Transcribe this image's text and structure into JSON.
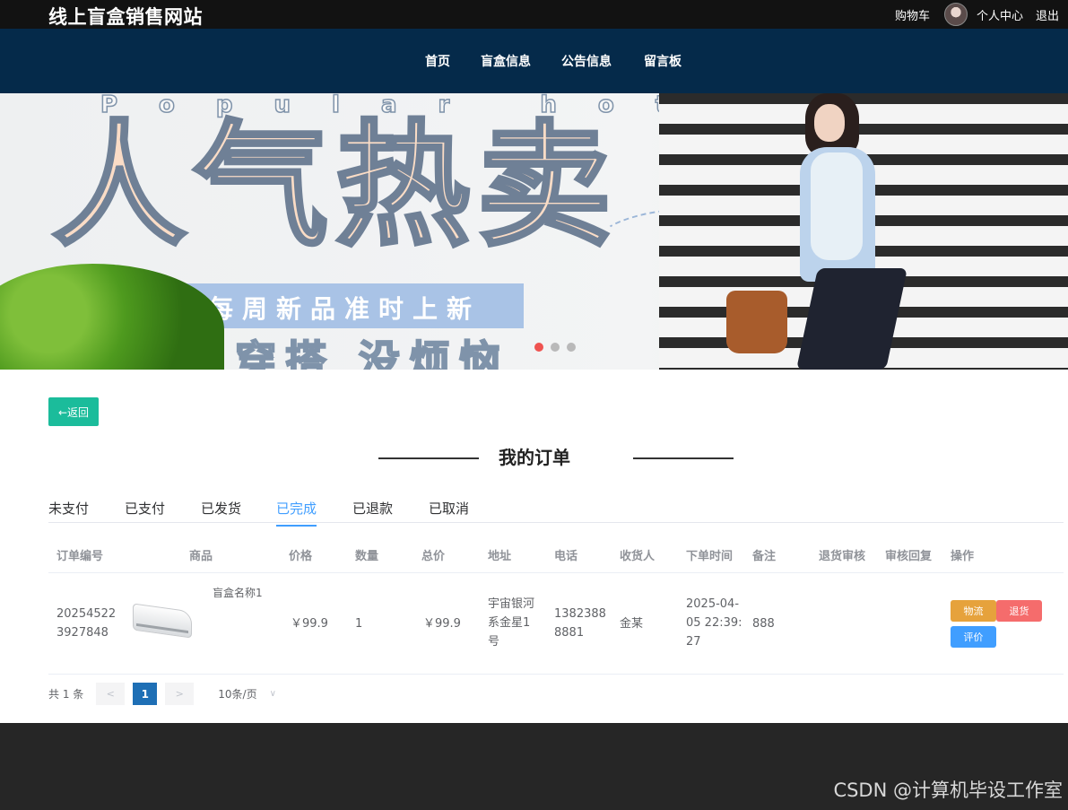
{
  "header": {
    "site_title": "线上盲盒销售网站",
    "cart": "购物车",
    "profile": "个人中心",
    "logout": "退出"
  },
  "nav": {
    "items": [
      "首页",
      "盲盒信息",
      "公告信息",
      "留言板"
    ]
  },
  "banner": {
    "english": "Popular hot",
    "headline": "人气热卖",
    "subline": "每周新品准时上新",
    "bottom_text": "穿搭 没烦恼",
    "slide_count": 3,
    "active_slide": 1
  },
  "page": {
    "back_label": "←返回",
    "title": "我的订单"
  },
  "tabs": [
    "未支付",
    "已支付",
    "已发货",
    "已完成",
    "已退款",
    "已取消"
  ],
  "active_tab": "已完成",
  "table": {
    "headers": [
      "订单编号",
      "商品",
      "价格",
      "数量",
      "总价",
      "地址",
      "电话",
      "收货人",
      "下单时间",
      "备注",
      "退货审核",
      "审核回复",
      "操作"
    ],
    "rows": [
      {
        "order_no": "20254522\n3927848",
        "product_name": "盲盒名称1",
        "price": "￥99.9",
        "qty": "1",
        "total": "￥99.9",
        "address": "宇宙银河\n系金星1\n号",
        "phone": "1382388\n8881",
        "receiver": "金某",
        "order_time": "2025-04-\n05 22:39:\n27",
        "remark": "888",
        "return_review": "",
        "review_reply": "",
        "actions": {
          "logistics": "物流",
          "return": "退货",
          "review": "评价"
        }
      }
    ]
  },
  "pagination": {
    "total": "共 1 条",
    "prev": "<",
    "current": "1",
    "next": ">",
    "page_size": "10条/页"
  },
  "watermark": "CSDN @计算机毕设工作室",
  "colors": {
    "nav_bg": "#052a4a",
    "topbar_bg": "#121212",
    "back_button": "#1bbc9b",
    "active_tab": "#409eff",
    "logistics_button": "#e6a23c",
    "return_button": "#f56c6c",
    "review_button": "#409eff",
    "current_page": "#1e6fb5",
    "footer_bg": "#262626"
  }
}
